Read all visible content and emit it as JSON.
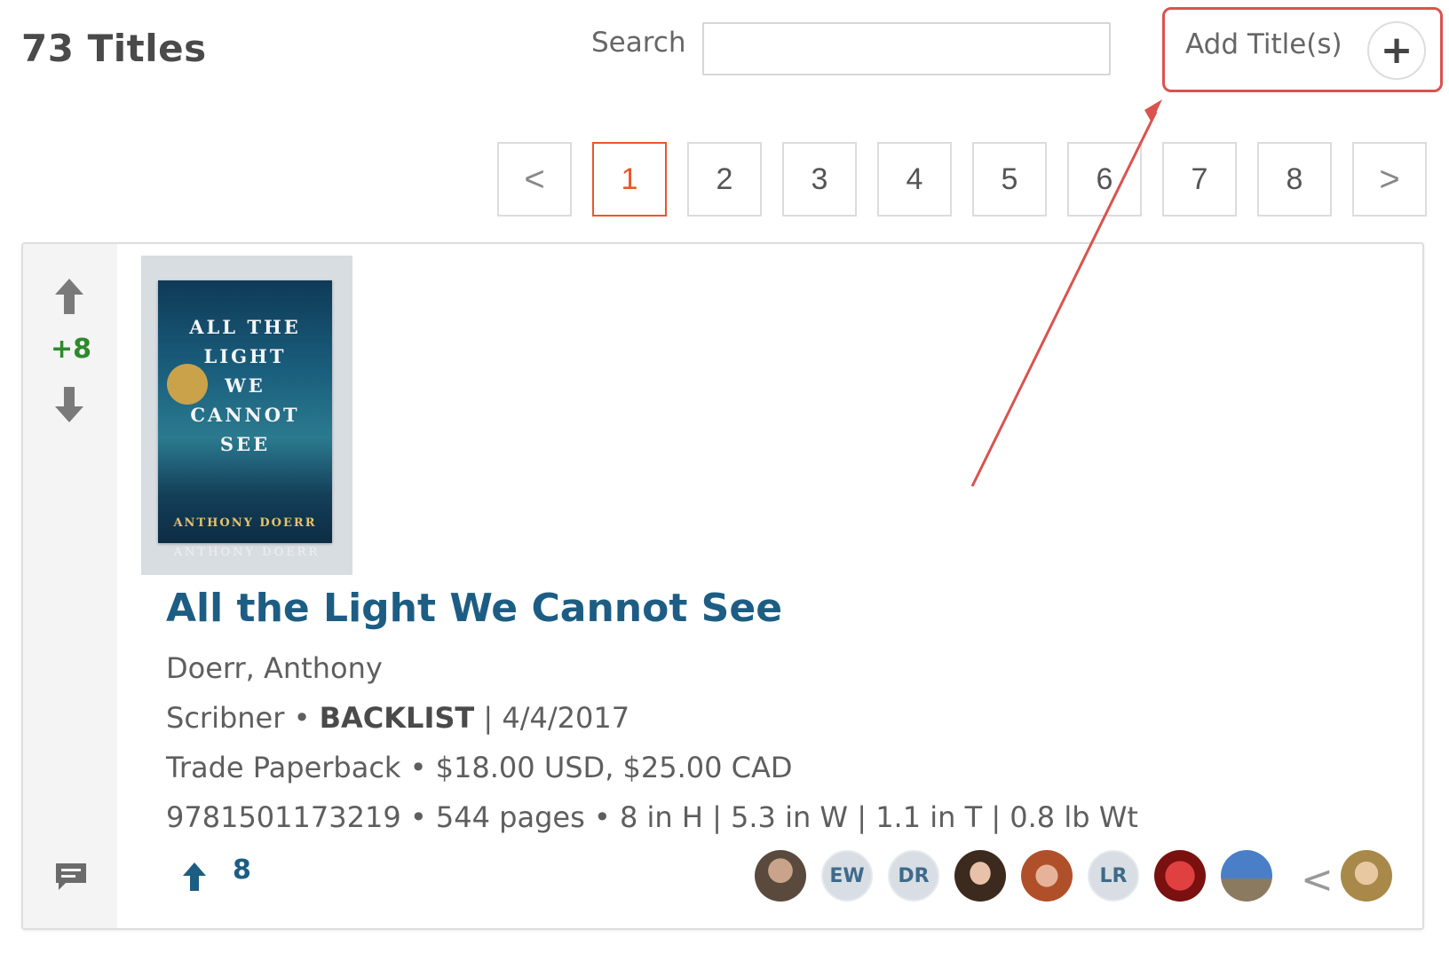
{
  "header": {
    "titles_count": "73 Titles",
    "search_label": "Search",
    "search_placeholder": "",
    "search_value": "",
    "add_titles_label": "Add Title(s)",
    "add_icon": "+"
  },
  "pagination": {
    "prev_label": "<",
    "next_label": ">",
    "pages": [
      "1",
      "2",
      "3",
      "4",
      "5",
      "6",
      "7",
      "8"
    ],
    "current_page": "1"
  },
  "title_card": {
    "vote_score": "+8",
    "cover": {
      "top_text": "",
      "title_text": "ALL THE LIGHT WE CANNOT SEE",
      "author_text": "ANTHONY DOERR"
    },
    "title": "All the Light We Cannot See",
    "author": "Doerr, Anthony",
    "publisher": "Scribner",
    "separator_dot": "•",
    "list_type": "BACKLIST",
    "pipe": "|",
    "pub_date": "4/4/2017",
    "format_line": "Trade Paperback • $18.00 USD, $25.00 CAD",
    "specs_line": "9781501173219 • 544 pages • 8 in H | 5.3 in W | 1.1 in T | 0.8 lb Wt",
    "likes_count": "8",
    "avatars": [
      {
        "type": "photo",
        "initials": ""
      },
      {
        "type": "initials",
        "initials": "EW"
      },
      {
        "type": "initials",
        "initials": "DR"
      },
      {
        "type": "photo",
        "initials": ""
      },
      {
        "type": "photo",
        "initials": ""
      },
      {
        "type": "initials",
        "initials": "LR"
      },
      {
        "type": "photo",
        "initials": ""
      },
      {
        "type": "photo",
        "initials": ""
      },
      {
        "type": "photo",
        "initials": ""
      }
    ],
    "avatar_prev_label": "<"
  },
  "colors": {
    "accent_orange": "#e8582d",
    "highlight_red": "#d9534f",
    "title_blue": "#1d5d84",
    "vote_green": "#2d8a2d"
  },
  "icons": [
    "plus-icon",
    "chevron-left-icon",
    "chevron-right-icon",
    "arrow-up-icon",
    "arrow-down-icon",
    "comment-icon"
  ]
}
